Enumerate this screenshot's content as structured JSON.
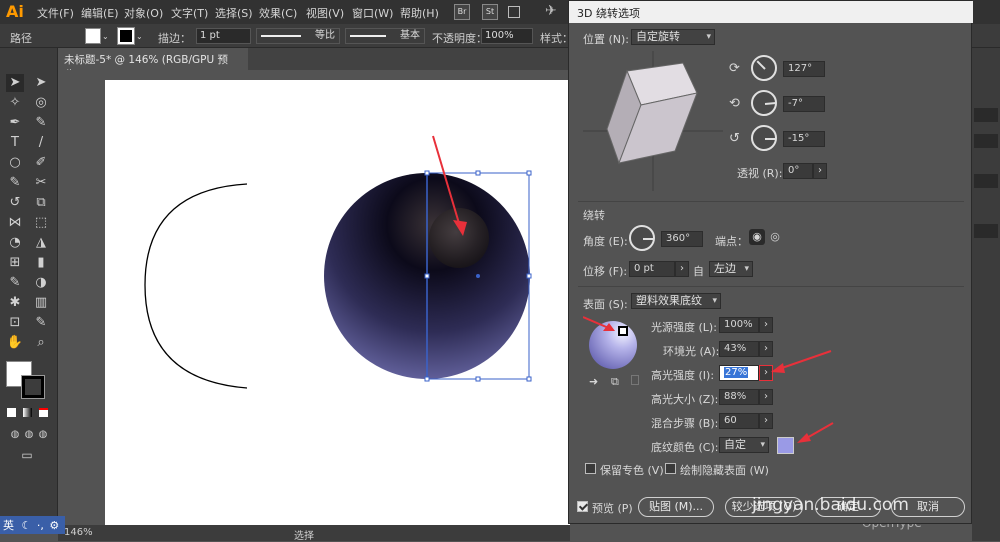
{
  "app": {
    "logo": "Ai",
    "menu": [
      "文件(F)",
      "编辑(E)",
      "对象(O)",
      "文字(T)",
      "选择(S)",
      "效果(C)",
      "视图(V)",
      "窗口(W)",
      "帮助(H)"
    ],
    "bridge_icons": [
      "Br",
      "St"
    ]
  },
  "controlbar": {
    "object_type": "路径",
    "stroke_label": "描边：",
    "stroke_value": "1 pt",
    "profile_label": "等比",
    "brush_label": "基本",
    "opacity_label": "不透明度：",
    "opacity_value": "100%",
    "style_label": "样式："
  },
  "document": {
    "tab_title": "未标题-5* @ 146% (RGB/GPU 预览)",
    "zoom": "146%",
    "status_tool": "选择"
  },
  "ime": {
    "label": "英"
  },
  "dialog": {
    "title": "3D 绕转选项",
    "position": {
      "label": "位置 (N):",
      "value": "自定旋转",
      "x_angle": "127°",
      "y_angle": "-7°",
      "z_angle": "-15°",
      "perspective_label": "透视 (R):",
      "perspective_value": "0°"
    },
    "revolve": {
      "section_label": "绕转",
      "angle_label": "角度 (E):",
      "angle_value": "360°",
      "cap_label": "端点：",
      "offset_label": "位移 (F):",
      "offset_value": "0 pt",
      "from_label": "自",
      "from_value": "左边"
    },
    "surface": {
      "label": "表面 (S):",
      "value": "塑料效果底纹",
      "light_intensity_label": "光源强度 (L):",
      "light_intensity_value": "100%",
      "ambient_label": "环境光 (A):",
      "ambient_value": "43%",
      "highlight_intensity_label": "高光强度 (I):",
      "highlight_intensity_value": "27%",
      "highlight_size_label": "高光大小 (Z):",
      "highlight_size_value": "88%",
      "blend_steps_label": "混合步骤 (B):",
      "blend_steps_value": "60",
      "shading_color_label": "底纹颜色 (C):",
      "shading_color_value": "自定",
      "shading_color_swatch": "#9a9ae6",
      "preserve_spot_label": "保留专色 (V)",
      "draw_hidden_label": "绘制隐藏表面 (W)"
    },
    "footer": {
      "preview_label": "预览 (P)",
      "map_button": "贴图 (M)...",
      "fewer_options_button": "较少选项 (O)",
      "ok_button": "确定",
      "cancel_button": "取消"
    }
  },
  "watermark": "jingyan.baidu.com",
  "rightpanel_text": "OpenType",
  "colors": {
    "sphere_light": "#6b6aa8",
    "sphere_dark": "#0c0a1a",
    "selection": "#3a62c9",
    "annotation_arrow": "#e8303a"
  }
}
